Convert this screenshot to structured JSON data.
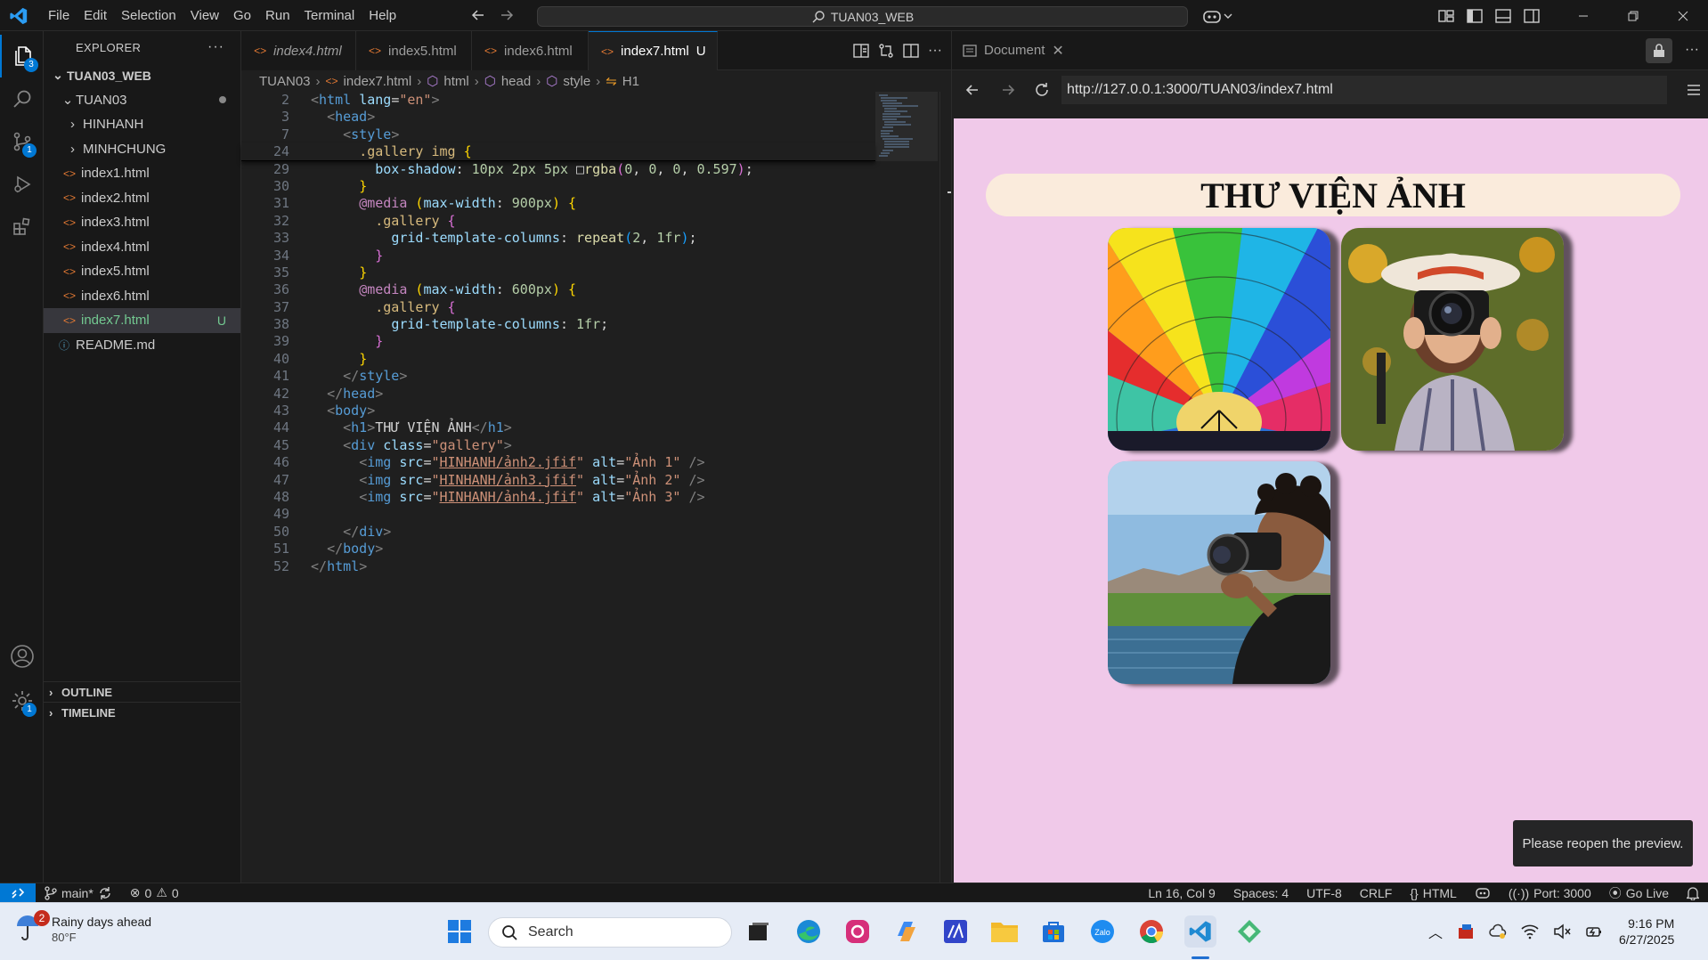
{
  "menu": [
    "File",
    "Edit",
    "Selection",
    "View",
    "Go",
    "Run",
    "Terminal",
    "Help"
  ],
  "command_center": "TUAN03_WEB",
  "activity_badges": {
    "explorer": "3",
    "scm": "1",
    "settings": "1"
  },
  "explorer": {
    "title": "EXPLORER",
    "workspace": "TUAN03_WEB",
    "folder": "TUAN03",
    "items": [
      {
        "label": "HINHANH",
        "type": "folder"
      },
      {
        "label": "MINHCHUNG",
        "type": "folder"
      },
      {
        "label": "index1.html",
        "type": "html"
      },
      {
        "label": "index2.html",
        "type": "html"
      },
      {
        "label": "index3.html",
        "type": "html"
      },
      {
        "label": "index4.html",
        "type": "html"
      },
      {
        "label": "index5.html",
        "type": "html"
      },
      {
        "label": "index6.html",
        "type": "html"
      },
      {
        "label": "index7.html",
        "type": "html",
        "status": "U"
      },
      {
        "label": "README.md",
        "type": "info"
      }
    ],
    "outline": "OUTLINE",
    "timeline": "TIMELINE"
  },
  "tabs": [
    {
      "label": "index4.html",
      "italic": true,
      "dirty": false
    },
    {
      "label": "index5.html",
      "dirty": true
    },
    {
      "label": "index6.html",
      "dirty": true
    },
    {
      "label": "index7.html",
      "suffix": "U",
      "dirty": true,
      "active": true
    }
  ],
  "breadcrumb": [
    "TUAN03",
    "index7.html",
    "html",
    "head",
    "style",
    "H1"
  ],
  "code_lines": [
    {
      "n": "2",
      "html": "<span class='t-br'>&lt;</span><span class='t-tag'>html</span> <span class='t-at'>lang</span><span class='t-tx'>=</span><span class='t-st'>\"en\"</span><span class='t-br'>&gt;</span>"
    },
    {
      "n": "3",
      "html": "  <span class='t-br'>&lt;</span><span class='t-tag'>head</span><span class='t-br'>&gt;</span>"
    },
    {
      "n": "7",
      "html": "    <span class='t-br'>&lt;</span><span class='t-tag'>style</span><span class='t-br'>&gt;</span>"
    },
    {
      "n": "24",
      "html": "      <span class='t-sel'>.gallery img</span> <span class='t-y'>{</span>",
      "sticky": true
    },
    {
      "n": "29",
      "html": "        <span class='t-pr'>box-shadow</span><span class='t-tx'>: </span><span class='t-nu'>10px 2px 5px</span> <span class='t-tx'>&#9633;</span><span class='t-fn'>rgba</span><span class='t-p'>(</span><span class='t-nu'>0</span><span class='t-tx'>, </span><span class='t-nu'>0</span><span class='t-tx'>, </span><span class='t-nu'>0</span><span class='t-tx'>, </span><span class='t-nu'>0.597</span><span class='t-p'>)</span><span class='t-tx'>;</span>"
    },
    {
      "n": "30",
      "html": "      <span class='t-y'>}</span>"
    },
    {
      "n": "31",
      "html": "      <span class='t-kw'>@media</span> <span class='t-y'>(</span><span class='t-pr'>max-width</span><span class='t-tx'>: </span><span class='t-nu'>900px</span><span class='t-y'>)</span> <span class='t-y'>{</span>"
    },
    {
      "n": "32",
      "html": "        <span class='t-sel'>.gallery</span> <span class='t-p'>{</span>"
    },
    {
      "n": "33",
      "html": "          <span class='t-pr'>grid-template-columns</span><span class='t-tx'>: </span><span class='t-fn'>repeat</span><span class='t-b'>(</span><span class='t-nu'>2</span><span class='t-tx'>, </span><span class='t-nu'>1fr</span><span class='t-b'>)</span><span class='t-tx'>;</span>"
    },
    {
      "n": "34",
      "html": "        <span class='t-p'>}</span>"
    },
    {
      "n": "35",
      "html": "      <span class='t-y'>}</span>"
    },
    {
      "n": "36",
      "html": "      <span class='t-kw'>@media</span> <span class='t-y'>(</span><span class='t-pr'>max-width</span><span class='t-tx'>: </span><span class='t-nu'>600px</span><span class='t-y'>)</span> <span class='t-y'>{</span>"
    },
    {
      "n": "37",
      "html": "        <span class='t-sel'>.gallery</span> <span class='t-p'>{</span>"
    },
    {
      "n": "38",
      "html": "          <span class='t-pr'>grid-template-columns</span><span class='t-tx'>: </span><span class='t-nu'>1fr</span><span class='t-tx'>;</span>"
    },
    {
      "n": "39",
      "html": "        <span class='t-p'>}</span>"
    },
    {
      "n": "40",
      "html": "      <span class='t-y'>}</span>"
    },
    {
      "n": "41",
      "html": "    <span class='t-br'>&lt;/</span><span class='t-tag'>style</span><span class='t-br'>&gt;</span>"
    },
    {
      "n": "42",
      "html": "  <span class='t-br'>&lt;/</span><span class='t-tag'>head</span><span class='t-br'>&gt;</span>"
    },
    {
      "n": "43",
      "html": "  <span class='t-br'>&lt;</span><span class='t-tag'>body</span><span class='t-br'>&gt;</span>"
    },
    {
      "n": "44",
      "html": "    <span class='t-br'>&lt;</span><span class='t-tag'>h1</span><span class='t-br'>&gt;</span><span class='t-tx'>THƯ VIỆN ẢNH</span><span class='t-br'>&lt;/</span><span class='t-tag'>h1</span><span class='t-br'>&gt;</span>"
    },
    {
      "n": "45",
      "html": "    <span class='t-br'>&lt;</span><span class='t-tag'>div</span> <span class='t-at'>class</span><span class='t-tx'>=</span><span class='t-st'>\"gallery\"</span><span class='t-br'>&gt;</span>"
    },
    {
      "n": "46",
      "html": "      <span class='t-br'>&lt;</span><span class='t-tag'>img</span> <span class='t-at'>src</span><span class='t-tx'>=</span><span class='t-st'>\"<u>HINHANH/ảnh2.jfif</u>\"</span> <span class='t-at'>alt</span><span class='t-tx'>=</span><span class='t-st'>\"Ảnh 1\"</span> <span class='t-br'>/&gt;</span>"
    },
    {
      "n": "47",
      "html": "      <span class='t-br'>&lt;</span><span class='t-tag'>img</span> <span class='t-at'>src</span><span class='t-tx'>=</span><span class='t-st'>\"<u>HINHANH/ảnh3.jfif</u>\"</span> <span class='t-at'>alt</span><span class='t-tx'>=</span><span class='t-st'>\"Ảnh 2\"</span> <span class='t-br'>/&gt;</span>"
    },
    {
      "n": "48",
      "html": "      <span class='t-br'>&lt;</span><span class='t-tag'>img</span> <span class='t-at'>src</span><span class='t-tx'>=</span><span class='t-st'>\"<u>HINHANH/ảnh4.jfif</u>\"</span> <span class='t-at'>alt</span><span class='t-tx'>=</span><span class='t-st'>\"Ảnh 3\"</span> <span class='t-br'>/&gt;</span>"
    },
    {
      "n": "49",
      "html": ""
    },
    {
      "n": "50",
      "html": "    <span class='t-br'>&lt;/</span><span class='t-tag'>div</span><span class='t-br'>&gt;</span>"
    },
    {
      "n": "51",
      "html": "  <span class='t-br'>&lt;/</span><span class='t-tag'>body</span><span class='t-br'>&gt;</span>"
    },
    {
      "n": "52",
      "html": "<span class='t-br'>&lt;/</span><span class='t-tag'>html</span><span class='t-br'>&gt;</span>"
    }
  ],
  "preview": {
    "tab_label": "Document",
    "url": "http://127.0.0.1:3000/TUAN03/index7.html",
    "heading": "THƯ VIỆN ẢNH",
    "images": [
      "hot-air-balloon",
      "woman-with-camera",
      "man-with-camera"
    ],
    "notice": "Please reopen the preview."
  },
  "status": {
    "branch": "main*",
    "errors": "0",
    "warnings": "0",
    "position": "Ln 16, Col 9",
    "spaces": "Spaces: 4",
    "encoding": "UTF-8",
    "eol": "CRLF",
    "language": "HTML",
    "port": "Port: 3000",
    "golive": "Go Live"
  },
  "taskbar": {
    "weather_title": "Rainy days ahead",
    "weather_temp": "80°F",
    "weather_badge": "2",
    "search": "Search",
    "time": "9:16 PM",
    "date": "6/27/2025"
  },
  "colors": {
    "accent": "#0078d4",
    "preview_bg": "#f0c9e9",
    "heading_bg": "#faebdc"
  }
}
